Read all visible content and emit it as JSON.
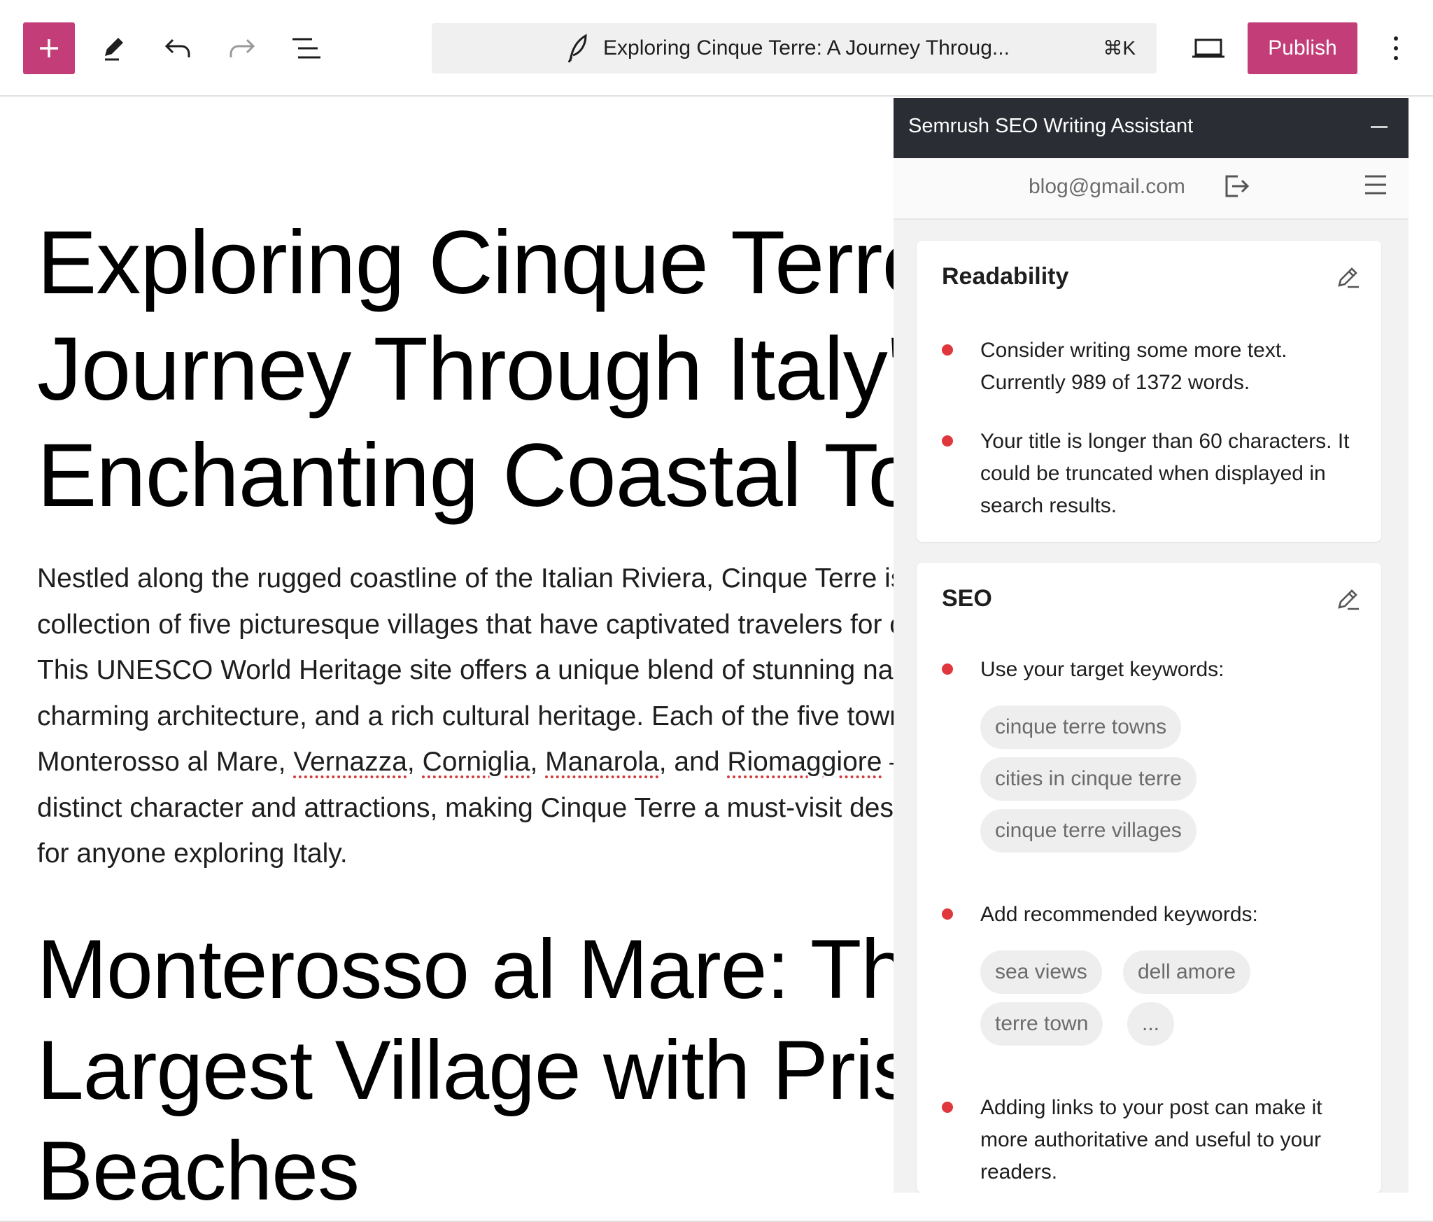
{
  "toolbar": {
    "add_icon": "plus-icon",
    "tools_icon": "pencil-icon",
    "undo_icon": "undo-icon",
    "redo_icon": "redo-icon",
    "outline_icon": "list-view-icon",
    "command_title": "Exploring Cinque Terre: A Journey Throug...",
    "command_shortcut": "⌘K",
    "view_icon": "laptop-icon",
    "publish_label": "Publish",
    "more_icon": "more-vertical-icon",
    "accent_color": "#c33e78"
  },
  "post": {
    "title_lines": [
      "Exploring Cinque Terre: A",
      "Journey Through Italy's",
      "Enchanting Coastal Towns"
    ],
    "paragraph": {
      "line1": "Nestled along the rugged coastline of the Italian Riviera, Cinque Terre is a",
      "line2": "collection of five picturesque villages that have captivated travelers for centuries.",
      "line3": "This UNESCO World Heritage site offers a unique blend of stunning natural beauty,",
      "line4": "charming architecture, and a rich cultural heritage. Each of the five towns –",
      "line5_a": "Monterosso al Mare, ",
      "line5_b": "Vernazza",
      "line5_c": ", ",
      "line5_d": "Corniglia",
      "line5_e": ", ",
      "line5_f": "Manarola",
      "line5_g": ", and ",
      "line5_h": "Riomaggiore",
      "line5_i": " – has its own",
      "line6": "distinct character and attractions, making Cinque Terre a must-visit destination",
      "line7": "for anyone exploring Italy."
    },
    "h2_lines": [
      "Monterosso al Mare: The",
      "Largest Village with Pristine",
      "Beaches"
    ]
  },
  "panel": {
    "title": "Semrush SEO Writing Assistant",
    "email": "blog@gmail.com",
    "readability": {
      "title": "Readability",
      "items": [
        "Consider writing some more text. Currently 989 of 1372 words.",
        "Your title is longer than 60 characters. It could be truncated when displayed in search results."
      ]
    },
    "seo": {
      "title": "SEO",
      "target_label": "Use your target keywords:",
      "target_keywords": [
        "cinque terre towns",
        "cities in cinque terre",
        "cinque terre villages"
      ],
      "recommended_label": "Add recommended keywords:",
      "recommended_keywords": [
        "sea views",
        "dell amore",
        "terre town",
        "..."
      ],
      "links_tip": "Adding links to your post can make it more authoritative and useful to your readers."
    },
    "status_color": "#e0363c"
  }
}
